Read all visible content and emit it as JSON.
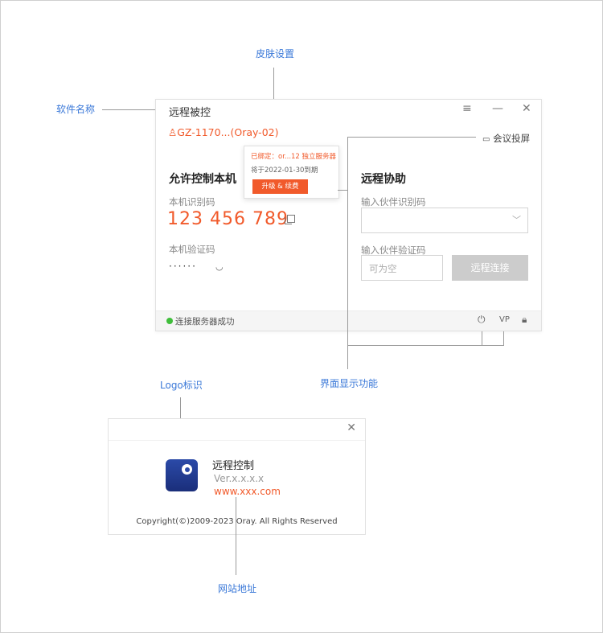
{
  "annotations": {
    "skin": "皮肤设置",
    "software_name": "软件名称",
    "ui_functions": "界面显示功能",
    "logo": "Logo标识",
    "website": "网站地址"
  },
  "window": {
    "title": "远程被控",
    "user_id": "GZ-1170...(Oray-02)",
    "meeting": "会议投屏",
    "allow_control": {
      "title": "允许控制本机",
      "code_label": "本机识别码",
      "code": "123 456 789",
      "verify_label": "本机验证码",
      "verify_value": "······"
    },
    "remote_assist": {
      "title": "远程协助",
      "partner_code_label": "输入伙伴识别码",
      "partner_verify_label": "输入伙伴验证码",
      "verify_placeholder": "可为空",
      "connect_button": "远程连接"
    },
    "status": {
      "text": "连接服务器成功",
      "color": "#3fbe3b"
    }
  },
  "popup": {
    "bound_text": "已绑定：or...12 独立服务器",
    "expire_text": "将于2022-01-30到期",
    "upgrade_button": "升级 & 续费"
  },
  "about": {
    "app_name": "远程控制",
    "version": "Ver.x.x.x.x",
    "website": "www.xxx.com",
    "copyright": "Copyright(©)2009-2023 Oray. All Rights Reserved"
  },
  "colors": {
    "accent": "#f15a2b",
    "annotation": "#3a78d8",
    "disabled_button": "#cccccc"
  },
  "icons": [
    "menu-icon",
    "minimize-icon",
    "close-icon",
    "user-icon",
    "monitor-icon",
    "copy-icon",
    "eye-closed-icon",
    "chevron-down-icon",
    "power-icon",
    "vpn-icon",
    "lock-icon"
  ]
}
